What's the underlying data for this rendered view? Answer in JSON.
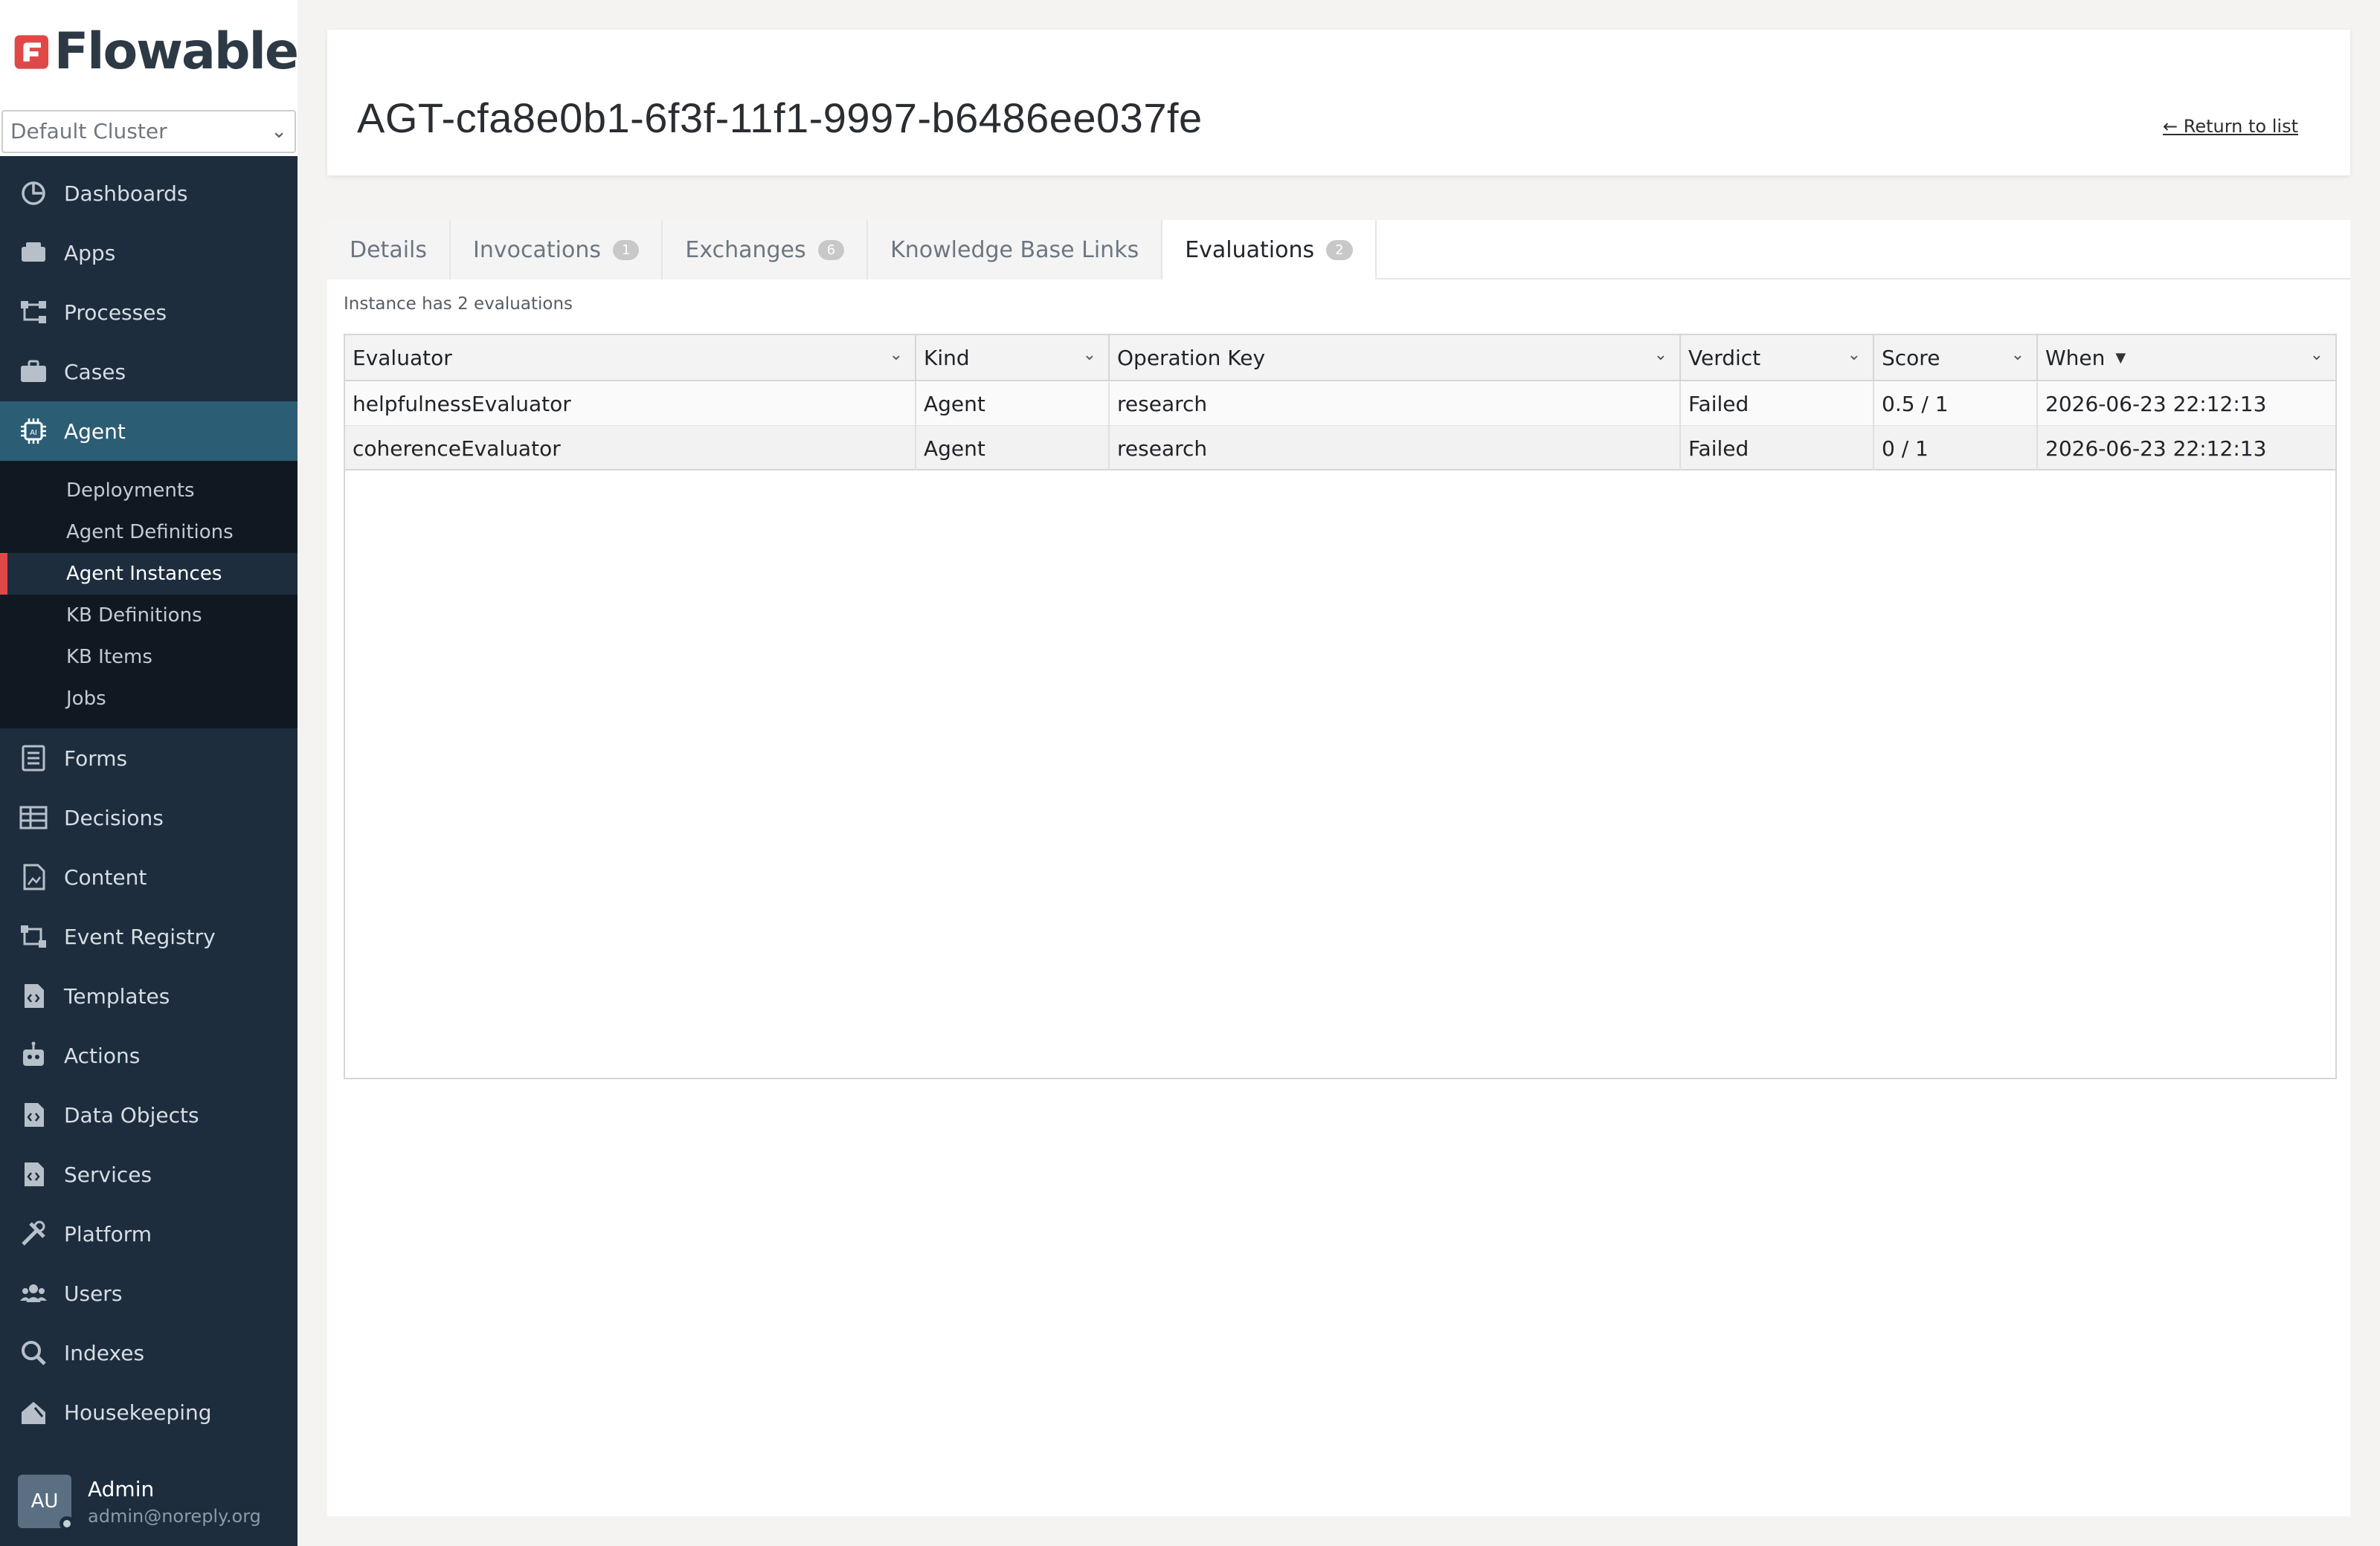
{
  "brand": {
    "logo_text": "Flowable",
    "accent": "#e04848"
  },
  "cluster": {
    "selected": "Default Cluster"
  },
  "nav": {
    "items": [
      {
        "label": "Dashboards",
        "icon": "dashboard-icon"
      },
      {
        "label": "Apps",
        "icon": "apps-icon"
      },
      {
        "label": "Processes",
        "icon": "process-icon"
      },
      {
        "label": "Cases",
        "icon": "briefcase-icon"
      },
      {
        "label": "Agent",
        "icon": "chip-icon",
        "active": true
      }
    ],
    "agent_sub": [
      {
        "label": "Deployments"
      },
      {
        "label": "Agent Definitions"
      },
      {
        "label": "Agent Instances",
        "active": true
      },
      {
        "label": "KB Definitions"
      },
      {
        "label": "KB Items"
      },
      {
        "label": "Jobs"
      }
    ],
    "items_after": [
      {
        "label": "Forms",
        "icon": "form-icon"
      },
      {
        "label": "Decisions",
        "icon": "table-icon"
      },
      {
        "label": "Content",
        "icon": "content-icon"
      },
      {
        "label": "Event Registry",
        "icon": "event-icon"
      },
      {
        "label": "Templates",
        "icon": "template-icon"
      },
      {
        "label": "Actions",
        "icon": "robot-icon"
      },
      {
        "label": "Data Objects",
        "icon": "data-object-icon"
      },
      {
        "label": "Services",
        "icon": "service-icon"
      },
      {
        "label": "Platform",
        "icon": "tools-icon"
      },
      {
        "label": "Users",
        "icon": "users-icon"
      },
      {
        "label": "Indexes",
        "icon": "search-icon"
      },
      {
        "label": "Housekeeping",
        "icon": "housekeeping-icon"
      }
    ]
  },
  "user": {
    "initials": "AU",
    "name": "Admin",
    "email": "admin@noreply.org"
  },
  "header": {
    "title": "AGT-cfa8e0b1-6f3f-11f1-9997-b6486ee037fe",
    "return_link": "← Return to list"
  },
  "tabs": [
    {
      "label": "Details",
      "badge": null
    },
    {
      "label": "Invocations",
      "badge": "1"
    },
    {
      "label": "Exchanges",
      "badge": "6"
    },
    {
      "label": "Knowledge Base Links",
      "badge": null
    },
    {
      "label": "Evaluations",
      "badge": "2",
      "active": true
    }
  ],
  "evaluations": {
    "caption": "Instance has 2 evaluations",
    "columns": [
      "Evaluator",
      "Kind",
      "Operation Key",
      "Verdict",
      "Score",
      "When"
    ],
    "rows": [
      [
        "helpfulnessEvaluator",
        "Agent",
        "research",
        "Failed",
        "0.5 / 1",
        "2026-06-23 22:12:13"
      ],
      [
        "coherenceEvaluator",
        "Agent",
        "research",
        "Failed",
        "0 / 1",
        "2026-06-23 22:12:13"
      ]
    ]
  }
}
